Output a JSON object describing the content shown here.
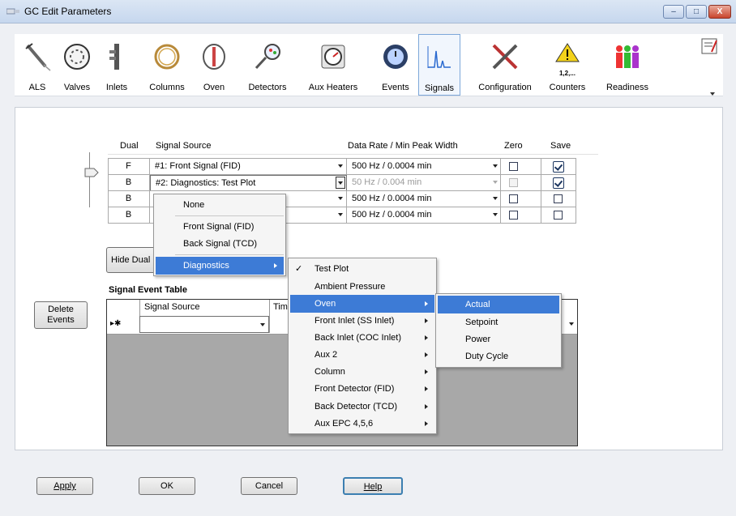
{
  "window": {
    "title": "GC Edit Parameters",
    "btn_min": "–",
    "btn_max": "□",
    "btn_close": "X"
  },
  "toolbar": {
    "items": [
      {
        "label": "ALS"
      },
      {
        "label": "Valves"
      },
      {
        "label": "Inlets"
      },
      {
        "label": "Columns"
      },
      {
        "label": "Oven"
      },
      {
        "label": "Detectors"
      },
      {
        "label": "Aux Heaters"
      },
      {
        "label": "Events"
      },
      {
        "label": "Signals"
      },
      {
        "label": "Configuration"
      },
      {
        "label": "Counters"
      },
      {
        "label": "Readiness"
      }
    ],
    "counters_icon_text": "1,2,...",
    "selected": "Signals"
  },
  "signals": {
    "headers": {
      "dual": "Dual",
      "source": "Signal Source",
      "rate": "Data Rate / Min Peak Width",
      "zero": "Zero",
      "save": "Save"
    },
    "rows": [
      {
        "dual": "F",
        "source": "#1: Front Signal (FID)",
        "rate": "500 Hz / 0.0004 min",
        "zero": false,
        "save": true,
        "rate_disabled": false
      },
      {
        "dual": "B",
        "source": "#2: Diagnostics: Test Plot",
        "rate": "50 Hz / 0.004 min",
        "zero": false,
        "save": true,
        "rate_disabled": true
      },
      {
        "dual": "B",
        "source": "",
        "rate": "500 Hz / 0.0004 min",
        "zero": false,
        "save": false,
        "rate_disabled": false
      },
      {
        "dual": "B",
        "source": "",
        "rate": "500 Hz / 0.0004 min",
        "zero": false,
        "save": false,
        "rate_disabled": false
      }
    ],
    "hide_dual_button": "Hide Dual"
  },
  "event_table": {
    "title": "Signal Event Table",
    "columns": [
      "Signal Source",
      "Tim"
    ],
    "new_row_marker": "▸✱",
    "delete_button": "Delete Events"
  },
  "menu1": {
    "items": [
      "None",
      "Front Signal (FID)",
      "Back Signal (TCD)",
      "Diagnostics"
    ],
    "highlighted": "Diagnostics"
  },
  "menu2": {
    "items": [
      "Test Plot",
      "Ambient Pressure",
      "Oven",
      "Front Inlet (SS Inlet)",
      "Back Inlet (COC Inlet)",
      "Aux 2",
      "Column",
      "Front Detector (FID)",
      "Back Detector (TCD)",
      "Aux EPC 4,5,6"
    ],
    "checked": "Test Plot",
    "highlighted": "Oven",
    "check_mark": "✓"
  },
  "menu3": {
    "items": [
      "Actual",
      "Setpoint",
      "Power",
      "Duty Cycle"
    ],
    "highlighted": "Actual"
  },
  "buttons": {
    "apply": "Apply",
    "ok": "OK",
    "cancel": "Cancel",
    "help": "Help"
  },
  "colors": {
    "accent": "#3d7bd6",
    "selected_tab_border": "#7da7d9",
    "grid_gray": "#a8a8a8"
  }
}
